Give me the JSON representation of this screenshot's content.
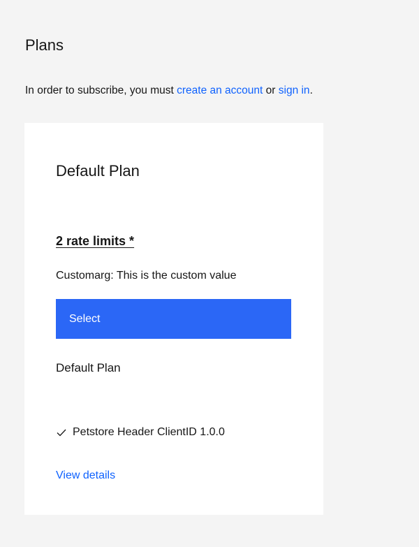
{
  "header": {
    "title": "Plans"
  },
  "notice": {
    "prefix": "In order to subscribe, you must ",
    "create_account_link": "create an account",
    "middle": " or ",
    "sign_in_link": "sign in",
    "suffix": "."
  },
  "plan_card": {
    "title": "Default Plan",
    "rate_limits": "2 rate limits *",
    "custom_arg": "Customarg: This is the custom value",
    "select_label": "Select",
    "plan_name": "Default Plan",
    "apis": [
      {
        "icon": "checkmark-icon",
        "label": "Petstore Header ClientID 1.0.0"
      }
    ],
    "view_details_label": "View details"
  },
  "colors": {
    "page_background": "#f4f4f4",
    "card_background": "#ffffff",
    "link": "#0f62fe",
    "button": "#2b67f6",
    "text": "#161616"
  }
}
